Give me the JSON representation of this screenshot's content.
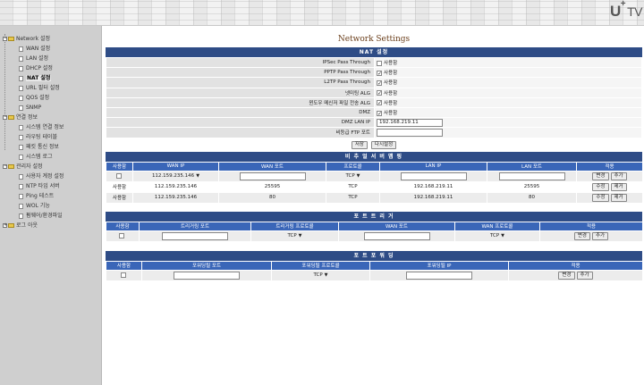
{
  "header": {
    "logo_u": "U",
    "logo_plus": "+",
    "logo_tv": "TV"
  },
  "sidebar": {
    "groups": [
      {
        "label": "Network 설정",
        "items": [
          "WAN 설정",
          "LAN 설정",
          "DHCP 설정",
          "NAT 설정",
          "URL 필터 설정",
          "QOS 설정",
          "SNMP"
        ]
      },
      {
        "label": "연결 정보",
        "items": [
          "시스템 연결 정보",
          "라우팅 테이블",
          "패킷 통신 정보",
          "시스템 로그"
        ]
      },
      {
        "label": "관리자 설정",
        "items": [
          "사용자 계정 설정",
          "NTP 타임 서버",
          "Ping 테스트",
          "WOL 기능",
          "펌웨어/환경파일"
        ]
      },
      {
        "label": "로그 아웃",
        "items": []
      }
    ],
    "active": "NAT 설정"
  },
  "page": {
    "title": "Network Settings"
  },
  "nat": {
    "title": "NAT 설정",
    "rows": [
      {
        "label": "IPSec Pass Through",
        "checked": false,
        "text": "사용함"
      },
      {
        "label": "PPTP Pass Through",
        "checked": true,
        "text": "사용함"
      },
      {
        "label": "L2TP Pass Through",
        "checked": true,
        "text": "사용함"
      },
      {
        "label": "넷미팅 ALG",
        "checked": true,
        "text": "사용함"
      },
      {
        "label": "윈도우 메신저 파일 전송 ALG",
        "checked": true,
        "text": "사용함"
      },
      {
        "label": "DMZ",
        "checked": true,
        "text": "사용함"
      }
    ],
    "dmz_lan_ip_label": "DMZ LAN IP",
    "dmz_lan_ip_value": "192.168.219.11",
    "unreg_ftp_label": "비등급 FTP 포트",
    "unreg_ftp_value": "",
    "save_label": "저장",
    "reset_label": "다시설정"
  },
  "virtual_server": {
    "title": "비 추 얼  서 버  맵 핑",
    "headers": [
      "사용함",
      "WAN IP",
      "WAN 포트",
      "프로토콜",
      "LAN IP",
      "LAN 포트",
      "적용"
    ],
    "input_row": {
      "wan_ip": "112.159.235.146",
      "protocol": "TCP",
      "btn_change": "변경",
      "btn_add": "추가"
    },
    "rows": [
      {
        "use": "사용함",
        "wan_ip": "112.159.235.146",
        "wan_port": "25595",
        "protocol": "TCP",
        "lan_ip": "192.168.219.11",
        "lan_port": "25595",
        "btn_edit": "수정",
        "btn_delete": "제거"
      },
      {
        "use": "사용함",
        "wan_ip": "112.159.235.146",
        "wan_port": "80",
        "protocol": "TCP",
        "lan_ip": "192.168.219.11",
        "lan_port": "80",
        "btn_edit": "수정",
        "btn_delete": "제거"
      }
    ]
  },
  "port_trigger": {
    "title": "포 트  트 리 거",
    "headers": [
      "사용함",
      "트리거링 포트",
      "트리거링 프로토콜",
      "WAN 포트",
      "WAN 프로토콜",
      "적용"
    ],
    "row": {
      "trigger_protocol": "TCP",
      "wan_protocol": "TCP",
      "btn_change": "변경",
      "btn_add": "추가"
    }
  },
  "port_forward": {
    "title": "포 트  포 워 딩",
    "headers": [
      "사용함",
      "포워딩될 포트",
      "포워딩될 프로토콜",
      "포워딩될 IP",
      "적용"
    ],
    "row": {
      "protocol": "TCP",
      "btn_change": "변경",
      "btn_add": "추가"
    }
  }
}
